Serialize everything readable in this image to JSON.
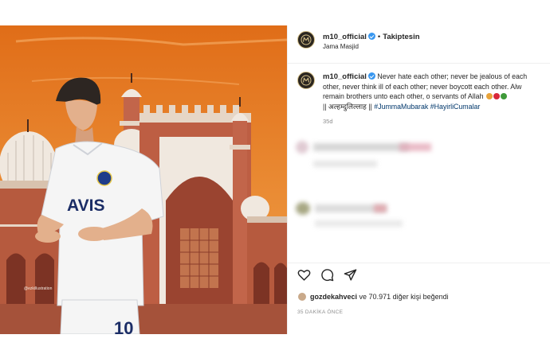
{
  "header": {
    "username": "m10_official",
    "separator": "•",
    "follow_status": "Takiptesin",
    "location": "Jama Masjid"
  },
  "caption": {
    "username": "m10_official",
    "line1": "Never hate each other; never be jealous of each",
    "line2": "other, never think ill of each other; never boycott each other. Alw",
    "line3": "remain brothers unto each other, o servants of Allah",
    "line4_text": "|| अल्हम्दुलिल्लाह ||",
    "hashtags": "#JummaMubarak #HayirliCumalar",
    "time": "35d"
  },
  "artwork": {
    "jersey_sponsor": "AVIS",
    "jersey_number": "10",
    "watermark": "@ezkillustration"
  },
  "engagement": {
    "liker": "gozdekahveci",
    "rest": "ve 70.971 diğer kişi beğendi",
    "posted_ago": "35 DAKİKA ÖNCE"
  },
  "colors": {
    "sky_top": "#e8781f",
    "sky_bottom": "#f3a34a",
    "mosque_red": "#b0503a",
    "hashtag_blue": "#00376b",
    "verified_blue": "#3897f0"
  }
}
